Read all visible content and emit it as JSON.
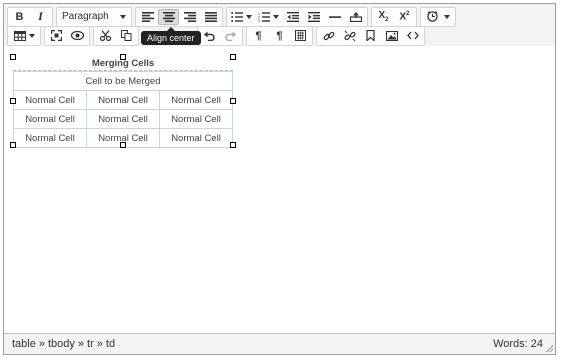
{
  "toolbar": {
    "bold_label": "B",
    "italic_label": "I",
    "block_format": "Paragraph",
    "tooltip": "Align center",
    "subscript_label": "X",
    "subscript_sub": "2",
    "superscript_label": "X",
    "superscript_sup": "2"
  },
  "table": {
    "caption": "Merging Cells",
    "merged_cell": "Cell to be Merged",
    "rows": [
      [
        "Normal Cell",
        "Normal Cell",
        "Normal Cell"
      ],
      [
        "Normal Cell",
        "Normal Cell",
        "Normal Cell"
      ],
      [
        "Normal Cell",
        "Normal Cell",
        "Normal Cell"
      ]
    ]
  },
  "statusbar": {
    "path": [
      "table",
      "tbody",
      "tr",
      "td"
    ],
    "separator": "»",
    "word_count": "Words: 24"
  },
  "icons": [
    "bold-icon",
    "italic-icon",
    "align-left-icon",
    "align-center-icon",
    "align-right-icon",
    "align-justify-icon",
    "bullet-list-icon",
    "numbered-list-icon",
    "outdent-icon",
    "indent-icon",
    "horizontal-rule-icon",
    "insert-icon",
    "clock-icon",
    "table-icon",
    "fullscreen-icon",
    "preview-icon",
    "cut-icon",
    "copy-icon",
    "undo-icon",
    "redo-icon",
    "show-blocks-icon",
    "paragraph-mark-icon",
    "special-chars-icon",
    "link-icon",
    "unlink-icon",
    "bookmark-icon",
    "image-icon",
    "code-icon"
  ]
}
